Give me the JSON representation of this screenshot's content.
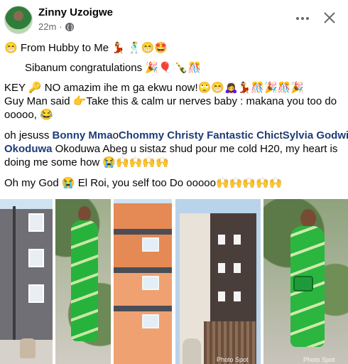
{
  "header": {
    "author_name": "Zinny Uzoigwe",
    "timestamp": "22m",
    "audience_icon": "globe-icon",
    "more_icon": "more-options-icon",
    "close_icon": "close-icon"
  },
  "post": {
    "line1": "😁 From Hubby to Me 💃 🕺😁🤩",
    "line2": "Sibanum congratulations 🎉🎈 🍾🎊",
    "line3": "KEY 🔑 NO amazim ihe m ga ekwu now!🙄😁🙇‍♀️💃🎊🎉🎊🎉",
    "line4": "Guy Man said 👉Take this & calm ur nerves baby : makana you too do",
    "line5": "ooooo, 😂",
    "line6_prefix": "oh jesuss ",
    "tag_bonny": "Bonny Mma",
    "tag_o1": "o",
    "tag_chommy": "Chommy Christy Fantastic Chic",
    "tag_t": "t",
    "tag_sylvia": "Sylvia Godwin",
    "tag_okoduwa": "Okoduwa",
    "line7_rest": " Okoduwa Abeg u sistaz shud pour me cold H20, my heart is",
    "line8": "doing me some how 😭🙌🙌🙌🙌",
    "line9": "Oh my God 😭 El Roi, you self too Do ooooo🙌🙌🙌🙌🙌"
  },
  "photos": {
    "caption_left": "Photo Spot",
    "caption_right": "Photo Spot"
  },
  "colors": {
    "tag": "#1f3c78",
    "secondary_text": "#65676b"
  }
}
